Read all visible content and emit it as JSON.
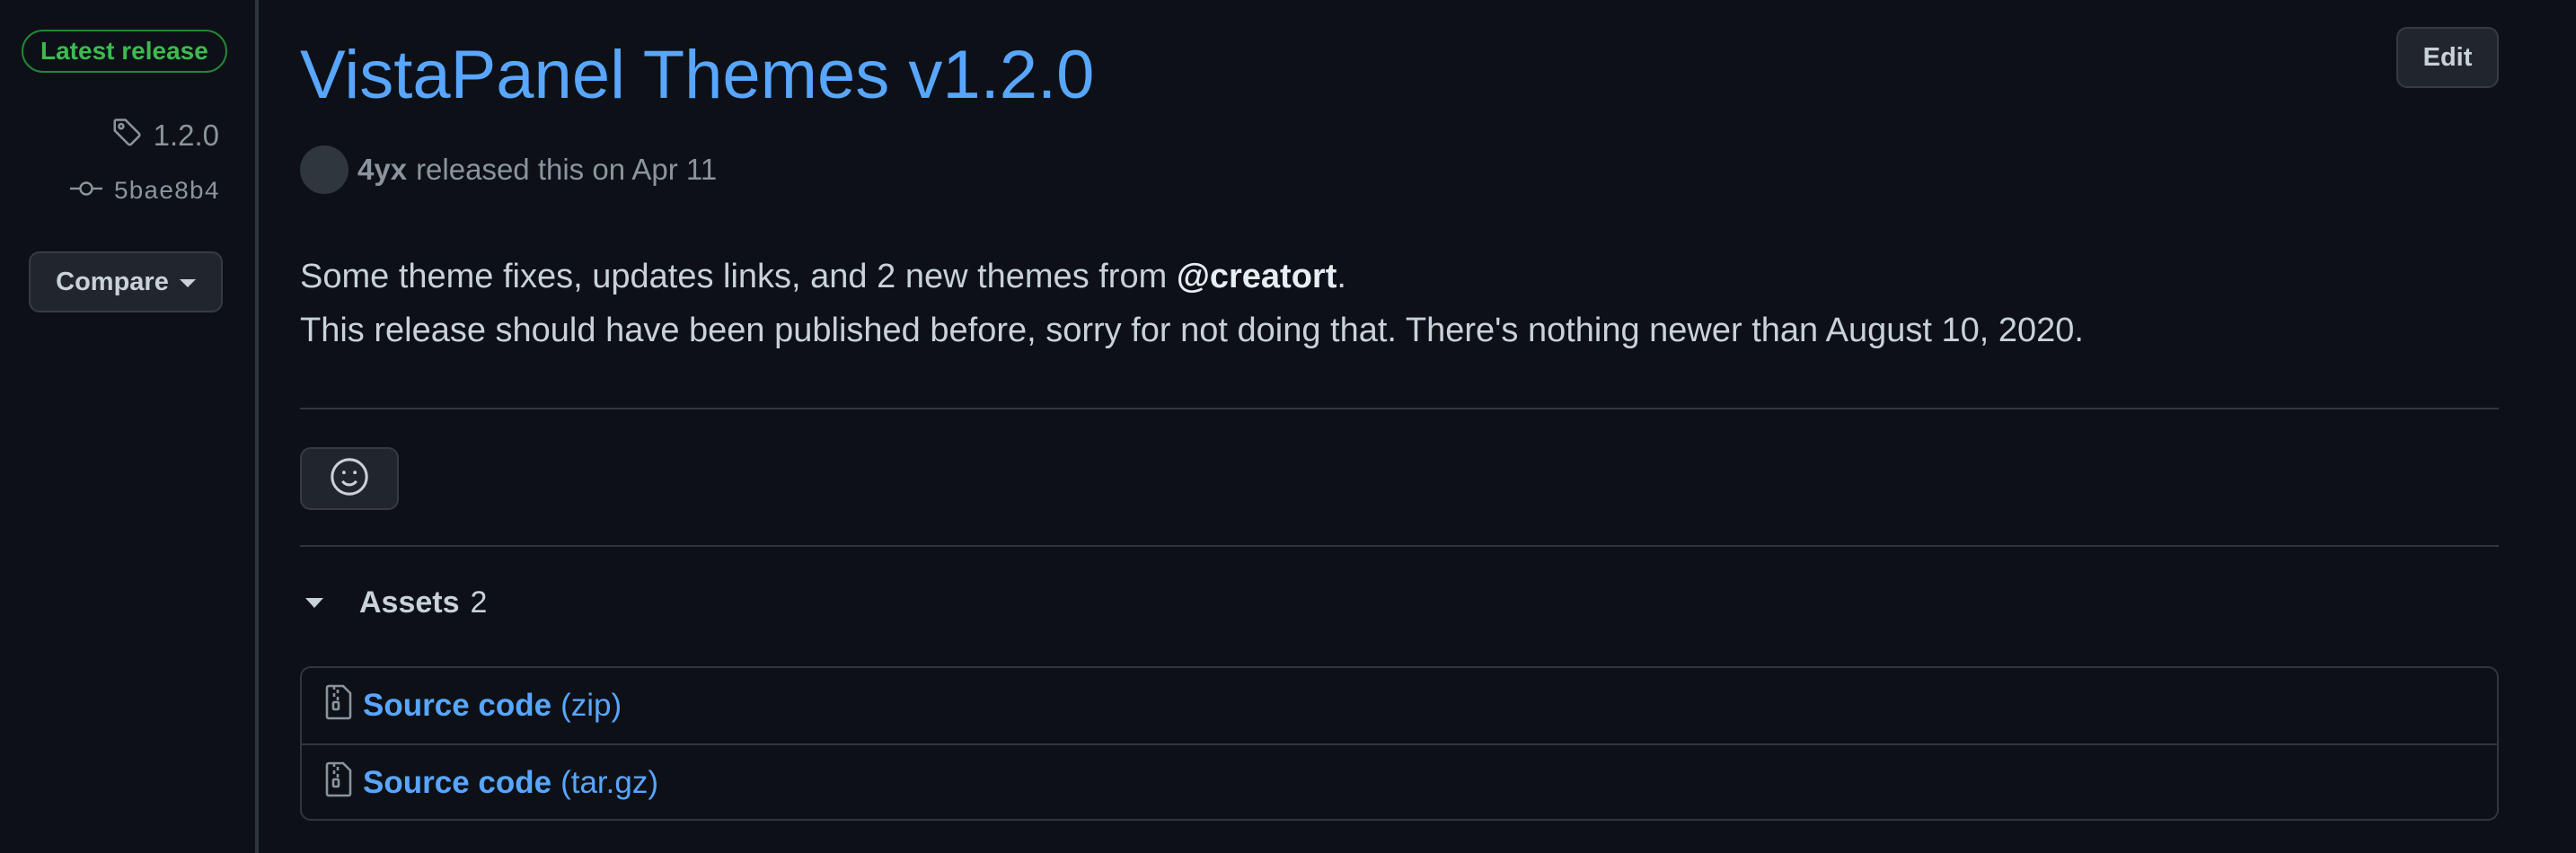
{
  "sidebar": {
    "latest_badge": "Latest release",
    "tag": "1.2.0",
    "tag_icon": "tag-icon",
    "commit": "5bae8b4",
    "commit_icon": "git-commit-icon",
    "compare_label": "Compare"
  },
  "release": {
    "title": "VistaPanel Themes v1.2.0",
    "edit_label": "Edit",
    "author": "4yx",
    "released_text": "released this on Apr 11",
    "body_line1_prefix": "Some theme fixes, updates links, and 2 new themes from ",
    "body_line1_mention": "@creatort",
    "body_line1_suffix": ".",
    "body_line2": "This release should have been published before, sorry for not doing that. There's nothing newer than August 10, 2020."
  },
  "reactions": {
    "icon": "smiley-icon"
  },
  "assets": {
    "label": "Assets",
    "count": "2",
    "items": [
      {
        "name": "Source code",
        "ext": "(zip)",
        "icon": "file-zip-icon"
      },
      {
        "name": "Source code",
        "ext": "(tar.gz)",
        "icon": "file-zip-icon"
      }
    ]
  },
  "colors": {
    "background": "#0d1117",
    "link": "#58a6ff",
    "success": "#3fb950",
    "border": "#30363d",
    "muted": "#8b949e"
  }
}
